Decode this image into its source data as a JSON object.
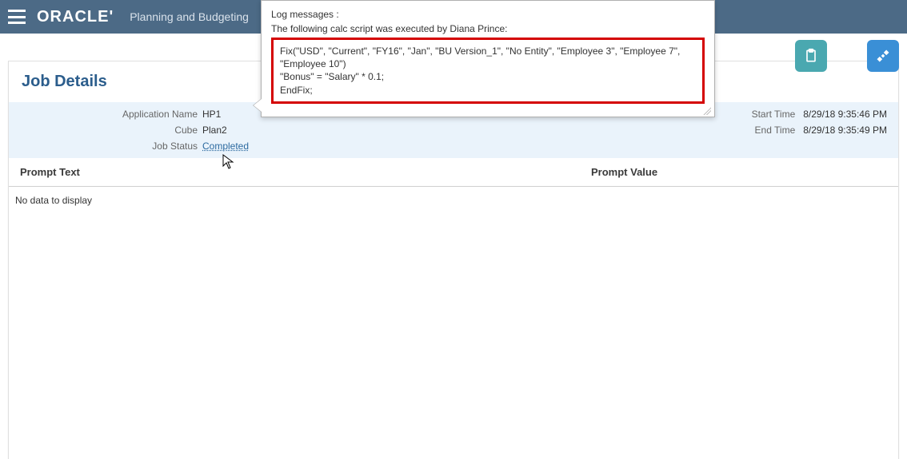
{
  "topbar": {
    "logo_text": "ORACLE'",
    "app_title": "Planning and Budgeting"
  },
  "page": {
    "card_title": "Job Details"
  },
  "details": {
    "app_name_label": "Application Name",
    "app_name_value": "HP1",
    "cube_label": "Cube",
    "cube_value": "Plan2",
    "status_label": "Job Status",
    "status_value": "Completed",
    "start_label": "Start Time",
    "start_value": "8/29/18 9:35:46 PM",
    "end_label": "End Time",
    "end_value": "8/29/18 9:35:49 PM"
  },
  "columns": {
    "prompt_text": "Prompt Text",
    "prompt_value": "Prompt Value"
  },
  "table": {
    "no_data": "No data to display"
  },
  "tooltip": {
    "line1": "Log messages :",
    "line2": "The following calc script was executed by Diana Prince:",
    "calc_script": "Fix(\"USD\", \"Current\", \"FY16\", \"Jan\", \"BU Version_1\", \"No Entity\", \"Employee 3\", \"Employee 7\", \"Employee 10\")\n\"Bonus\" = \"Salary\" * 0.1;\nEndFix;"
  },
  "icons": {
    "hamburger": "hamburger-icon",
    "clipboard": "clipboard-icon",
    "tools": "tools-icon"
  }
}
